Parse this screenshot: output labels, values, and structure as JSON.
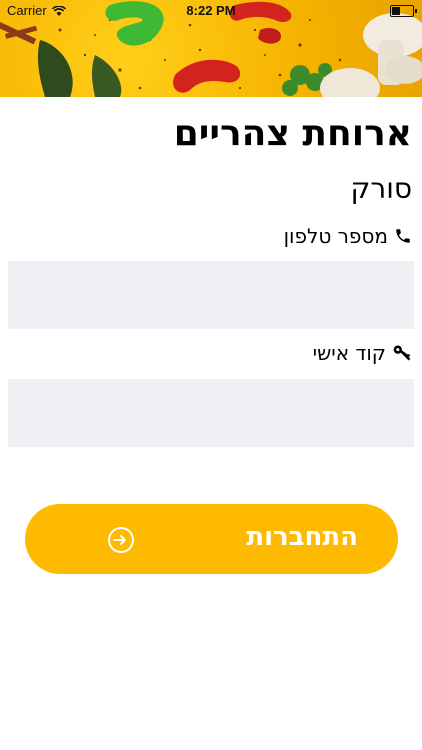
{
  "status_bar": {
    "carrier": "Carrier",
    "time": "8:22 PM"
  },
  "header": {
    "title": "ארוחת צהריים",
    "subtitle": "סורק"
  },
  "form": {
    "phone_label": "מספר טלפון",
    "phone_value": "",
    "code_label": "קוד אישי",
    "code_value": ""
  },
  "login_button": {
    "label": "התחברות"
  },
  "colors": {
    "accent": "#fdba00",
    "input_bg": "#efeff4"
  },
  "icons": {
    "phone": "phone-icon",
    "key": "key-icon",
    "login": "sign-in-icon"
  }
}
